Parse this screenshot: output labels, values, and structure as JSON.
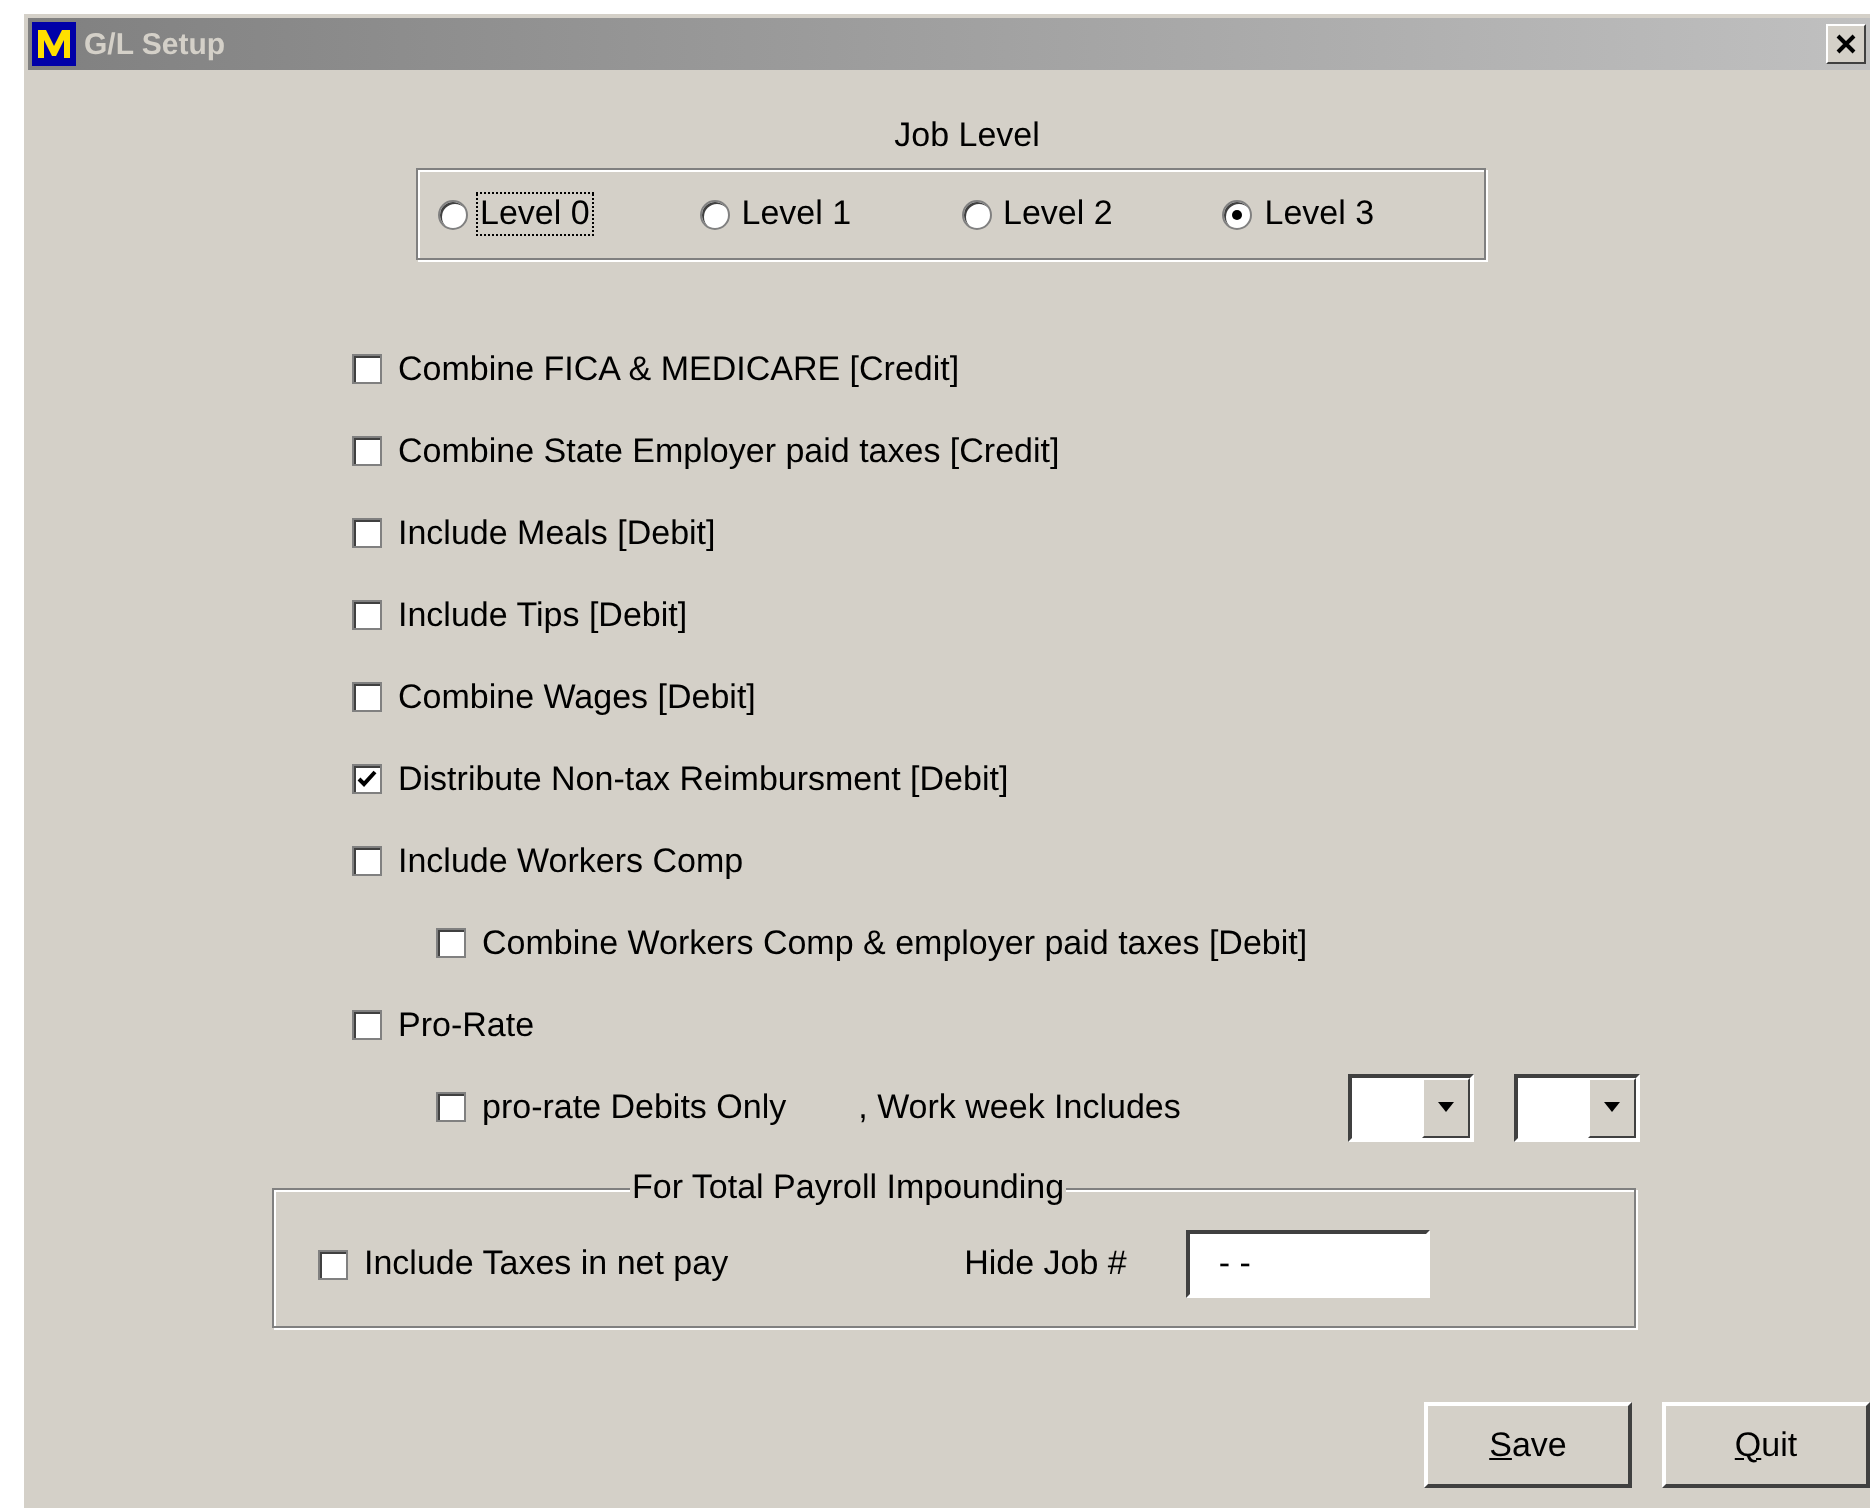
{
  "window": {
    "title": "G/L Setup"
  },
  "job_level": {
    "title": "Job Level",
    "options": [
      {
        "label": "Level 0",
        "selected": false,
        "focused": true
      },
      {
        "label": "Level 1",
        "selected": false,
        "focused": false
      },
      {
        "label": "Level 2",
        "selected": false,
        "focused": false
      },
      {
        "label": "Level 3",
        "selected": true,
        "focused": false
      }
    ]
  },
  "options": [
    {
      "label": "Combine FICA & MEDICARE [Credit]",
      "checked": false
    },
    {
      "label": "Combine State Employer paid taxes [Credit]",
      "checked": false
    },
    {
      "label": "Include Meals [Debit]",
      "checked": false
    },
    {
      "label": "Include Tips [Debit]",
      "checked": false
    },
    {
      "label": "Combine Wages [Debit]",
      "checked": false
    },
    {
      "label": "Distribute Non-tax Reimbursment [Debit]",
      "checked": true
    },
    {
      "label": "Include Workers Comp",
      "checked": false,
      "children": [
        {
          "label": "Combine Workers Comp & employer paid taxes [Debit]",
          "checked": false
        }
      ]
    },
    {
      "label": "Pro-Rate",
      "checked": false,
      "children": [
        {
          "label": "pro-rate Debits Only",
          "checked": false
        }
      ]
    }
  ],
  "work_week": {
    "label": ", Work week Includes"
  },
  "impounding": {
    "title": "For Total Payroll Impounding",
    "include_taxes": {
      "label": "Include Taxes in net pay",
      "checked": false
    },
    "hide_job": {
      "label": "Hide Job #",
      "value": "- -"
    }
  },
  "buttons": [
    {
      "label": "Save"
    },
    {
      "label": "Quit"
    }
  ]
}
